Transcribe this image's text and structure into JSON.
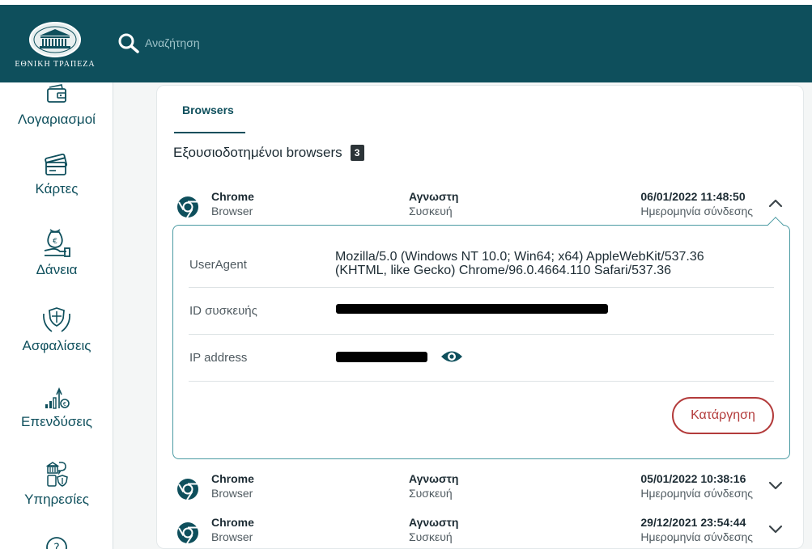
{
  "header": {
    "logo_text": "ΕΘΝΙΚΗ ΤΡΑΠΕΖΑ",
    "search_placeholder": "Αναζήτηση",
    "bg_color": "#0e4f5c"
  },
  "sidebar": {
    "items": [
      {
        "label": "Λογαριασμοί",
        "icon": "wallet-icon"
      },
      {
        "label": "Κάρτες",
        "icon": "cards-icon"
      },
      {
        "label": "Δάνεια",
        "icon": "loan-hand-icon"
      },
      {
        "label": "Ασφαλίσεις",
        "icon": "shield-hands-icon"
      },
      {
        "label": "Επενδύσεις",
        "icon": "investment-chart-icon"
      },
      {
        "label": "Υπηρεσίες",
        "icon": "services-icon"
      },
      {
        "label": "",
        "icon": "help-icon"
      }
    ]
  },
  "tabs": [
    {
      "label": "Browsers",
      "active": true
    }
  ],
  "section": {
    "title": "Εξουσιοδοτημένοι browsers",
    "count": "3"
  },
  "browsers": [
    {
      "name": "Chrome",
      "type": "Browser",
      "device": "Αγνωστη",
      "device_label": "Συσκευή",
      "date": "06/01/2022 11:48:50",
      "date_label": "Ημερομηνία σύνδεσης",
      "expanded": true
    },
    {
      "name": "Chrome",
      "type": "Browser",
      "device": "Αγνωστη",
      "device_label": "Συσκευή",
      "date": "05/01/2022 10:38:16",
      "date_label": "Ημερομηνία σύνδεσης",
      "expanded": false
    },
    {
      "name": "Chrome",
      "type": "Browser",
      "device": "Αγνωστη",
      "device_label": "Συσκευή",
      "date": "29/12/2021 23:54:44",
      "date_label": "Ημερομηνία σύνδεσης",
      "expanded": false
    }
  ],
  "details": {
    "useragent_label": "UserAgent",
    "useragent_line1": "Mozilla/5.0 (Windows NT 10.0; Win64; x64) AppleWebKit/537.36",
    "useragent_line2": "(KHTML, like Gecko) Chrome/96.0.4664.110 Safari/537.36",
    "device_id_label": "ID συσκευής",
    "ip_label": "IP address",
    "remove_button": "Κατάργηση"
  },
  "colors": {
    "accent": "#0e4f5c",
    "danger": "#b33b3b",
    "border": "#4a9aa2"
  }
}
